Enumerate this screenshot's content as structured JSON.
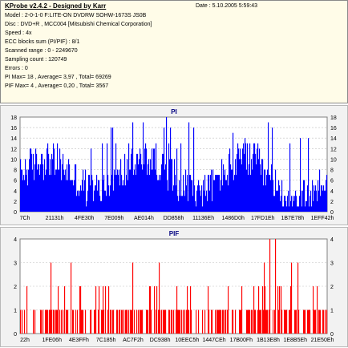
{
  "header": {
    "title": "KProbe v2.4.2 - Designed by Karr",
    "date": "Date : 5.10.2005 5:59:43",
    "lines": [
      "Model : 2-0-1-0 F:LITE-ON DVDRW SOHW-1673S JS0B",
      "Disc : DVD+R , MCC004 [Mitsubishi Chemical Corporation]",
      "Speed : 4x",
      "ECC blocks sum (PI/PIF) : 8/1",
      "Scanned range : 0 - 2249670",
      "Sampling count : 120749",
      "Errors : 0",
      "PI Max= 18 , Average= 3,97 , Total= 69269",
      "PIF Max= 4 , Average= 0,20 , Total= 3567"
    ]
  },
  "chart_data": [
    {
      "type": "bar",
      "title": "PI",
      "ylim": [
        0,
        18
      ],
      "yticks": [
        "0",
        "2",
        "4",
        "6",
        "8",
        "10",
        "12",
        "14",
        "16",
        "18"
      ],
      "xticks": [
        "7Ch",
        "21131h",
        "4FE30h",
        "7E009h",
        "AE014h",
        "DD858h",
        "11136Eh",
        "1486D0h",
        "17FD1Eh",
        "1B7E78h",
        "1EFF42h"
      ],
      "grid": true,
      "color": "#0000ff",
      "max": 18,
      "average": 3.97,
      "note": "dense per-sample series; bar heights mostly 4-12, peaks to 18, lower values toward disc end"
    },
    {
      "type": "bar",
      "title": "PIF",
      "ylim": [
        0,
        4
      ],
      "yticks": [
        "0",
        "1",
        "2",
        "3",
        "4"
      ],
      "xticks": [
        "22h",
        "1FE06h",
        "4E3FFh",
        "7C185h",
        "AC7F2h",
        "DC938h",
        "10EEC5h",
        "1447CEh",
        "17B00Fh",
        "1B13E8h",
        "1E8B5Eh",
        "21E50Eh"
      ],
      "grid": true,
      "color": "#ff0000",
      "max": 4,
      "average": 0.2,
      "note": "sparse spikes; mostly 0-1, a few 2-3, peaks of 4 near 1B13E8h"
    }
  ]
}
